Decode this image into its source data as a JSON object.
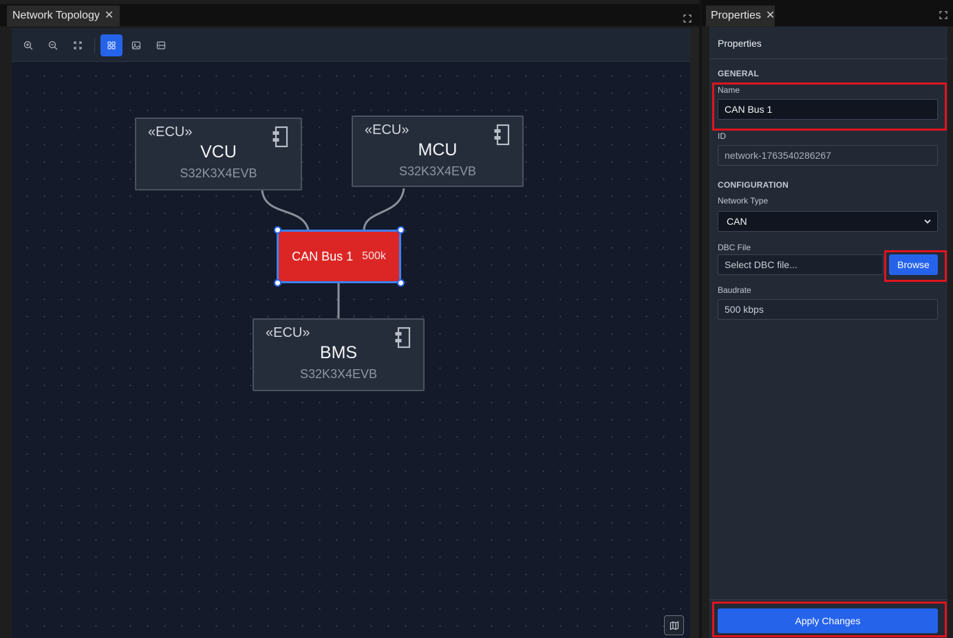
{
  "left_panel": {
    "tab_title": "Network Topology",
    "toolbar": {
      "buttons": [
        "zoom-in",
        "zoom-out",
        "fit-view",
        "grid-layout",
        "export-image",
        "toggle-split"
      ],
      "active": "grid-layout"
    }
  },
  "diagram": {
    "ecus": [
      {
        "stereotype": "«ECU»",
        "name": "VCU",
        "board": "S32K3X4EVB"
      },
      {
        "stereotype": "«ECU»",
        "name": "MCU",
        "board": "S32K3X4EVB"
      },
      {
        "stereotype": "«ECU»",
        "name": "BMS",
        "board": "S32K3X4EVB"
      }
    ],
    "bus": {
      "name": "CAN Bus 1",
      "speed": "500k",
      "color": "#dc2626",
      "selected": true
    }
  },
  "right_panel": {
    "tab_title": "Properties",
    "header": "Properties",
    "sections": {
      "general": "GENERAL",
      "configuration": "CONFIGURATION"
    },
    "fields": {
      "name": {
        "label": "Name",
        "value": "CAN Bus 1"
      },
      "id": {
        "label": "ID",
        "value": "network-1763540286267"
      },
      "network_type": {
        "label": "Network Type",
        "value": "CAN"
      },
      "dbc_file": {
        "label": "DBC File",
        "placeholder": "Select DBC file...",
        "browse_label": "Browse"
      },
      "baudrate": {
        "label": "Baudrate",
        "value": "500 kbps"
      }
    },
    "apply_label": "Apply Changes"
  },
  "colors": {
    "accent": "#2563eb",
    "highlight": "#e0141e",
    "bus": "#dc2626"
  }
}
